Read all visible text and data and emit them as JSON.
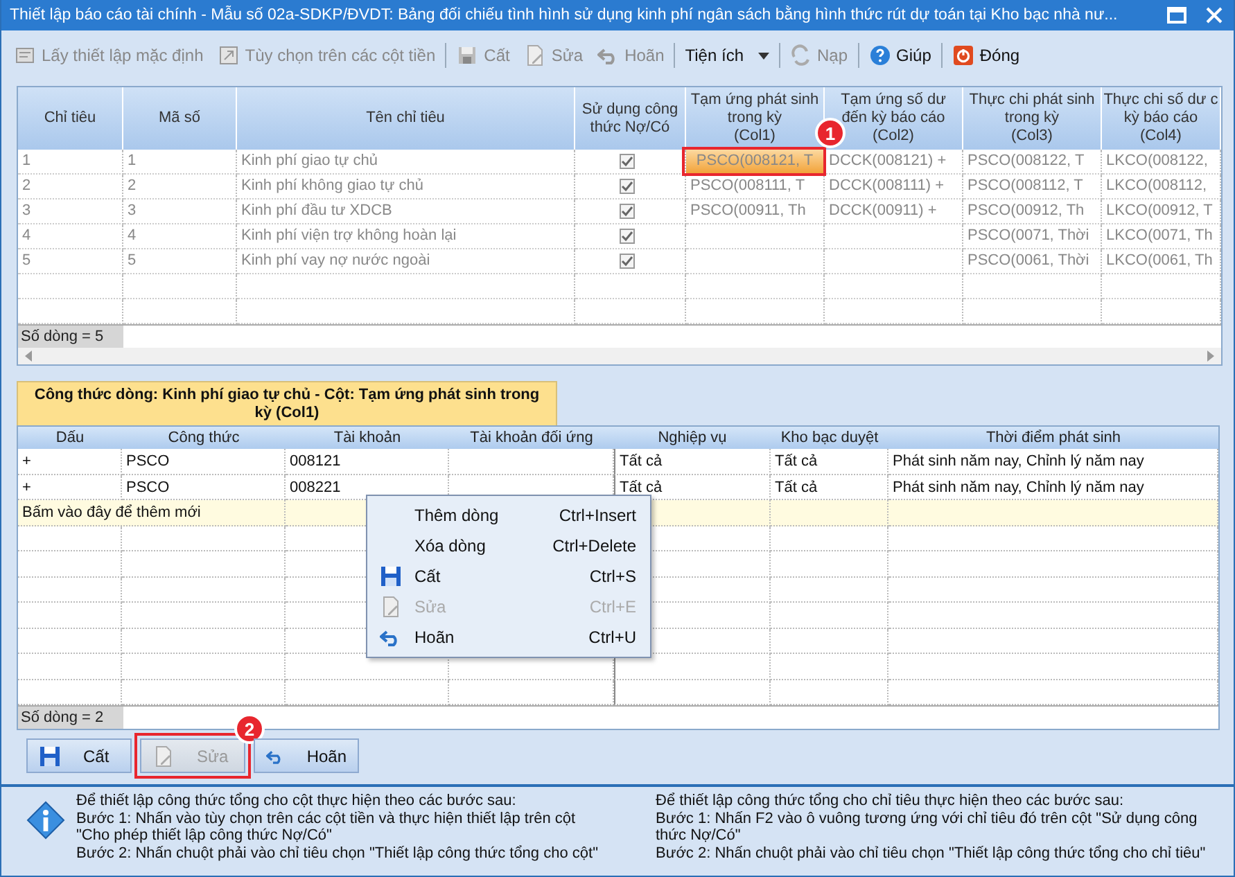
{
  "window": {
    "title": "Thiết lập báo cáo tài chính - Mẫu số 02a-SDKP/ĐVDT: Bảng đối chiếu tình hình sử dụng kinh phí ngân sách bằng hình thức rút dự toán tại Kho bạc nhà nư..."
  },
  "toolbar": [
    {
      "kind": "button",
      "label": "Lấy thiết lập mặc định",
      "disabled": true
    },
    {
      "kind": "button",
      "label": "Tùy chọn trên các cột tiền",
      "disabled": true
    },
    {
      "kind": "separator"
    },
    {
      "kind": "button",
      "label": "Cất",
      "disabled": true
    },
    {
      "kind": "button",
      "label": "Sửa",
      "disabled": true
    },
    {
      "kind": "button",
      "label": "Hoãn",
      "disabled": true
    },
    {
      "kind": "separator"
    },
    {
      "kind": "dropdown",
      "label": "Tiện ích",
      "disabled": false
    },
    {
      "kind": "separator"
    },
    {
      "kind": "button",
      "label": "Nạp",
      "disabled": true
    },
    {
      "kind": "separator"
    },
    {
      "kind": "button",
      "label": "Giúp",
      "disabled": false
    },
    {
      "kind": "separator"
    },
    {
      "kind": "button",
      "label": "Đóng",
      "disabled": false
    }
  ],
  "top_grid": {
    "columns": [
      "Chỉ tiêu",
      "Mã số",
      "Tên chỉ tiêu",
      "Sử dụng công\nthức Nợ/Có",
      "Tạm ứng phát sinh\ntrong kỳ\n(Col1)",
      "Tạm ứng số dư\nđến kỳ báo cáo\n(Col2)",
      "Thực chi phát sinh\ntrong kỳ\n(Col3)",
      "Thực chi số dư c\nkỳ báo cáo\n(Col4)"
    ],
    "rows": [
      {
        "checked": true,
        "cells": [
          "1",
          "1",
          "Kinh phí giao tự chủ",
          ""
        ],
        "values": [
          {
            "text": "PSCO(008121, T",
            "selected": true
          },
          {
            "text": "DCCK(008121) +",
            "selected": false
          },
          {
            "text": "PSCO(008122, T",
            "selected": false
          },
          {
            "text": "LKCO(008122,",
            "selected": false
          }
        ]
      },
      {
        "checked": true,
        "cells": [
          "2",
          "2",
          "Kinh phí không giao tự chủ",
          ""
        ],
        "values": [
          {
            "text": "PSCO(008111, T",
            "selected": false
          },
          {
            "text": "DCCK(008111) +",
            "selected": false
          },
          {
            "text": "PSCO(008112, T",
            "selected": false
          },
          {
            "text": "LKCO(008112,",
            "selected": false
          }
        ]
      },
      {
        "checked": true,
        "cells": [
          "3",
          "3",
          "Kinh phí đầu tư XDCB",
          ""
        ],
        "values": [
          {
            "text": "PSCO(00911, Th",
            "selected": false
          },
          {
            "text": "DCCK(00911) +",
            "selected": false
          },
          {
            "text": "PSCO(00912, Th",
            "selected": false
          },
          {
            "text": "LKCO(00912, T",
            "selected": false
          }
        ]
      },
      {
        "checked": true,
        "cells": [
          "4",
          "4",
          "Kinh phí viện trợ không hoàn lại",
          ""
        ],
        "values": [
          {
            "selected": false
          },
          {
            "selected": false
          },
          {
            "text": "PSCO(0071, Thời",
            "selected": false
          },
          {
            "text": "LKCO(0071, Th",
            "selected": false
          }
        ]
      },
      {
        "checked": true,
        "cells": [
          "5",
          "5",
          "Kinh phí vay nợ nước ngoài",
          ""
        ],
        "values": [
          {
            "selected": false
          },
          {
            "selected": false
          },
          {
            "text": "PSCO(0061, Thời",
            "selected": false
          },
          {
            "text": "LKCO(0061, Th",
            "selected": false
          }
        ]
      }
    ],
    "callout": "1",
    "status": "Số dòng = 5"
  },
  "formula_panel": {
    "tab": "Công thức dòng: Kinh phí giao tự chủ - Cột: Tạm ứng phát sinh trong kỳ (Col1)",
    "columns": [
      "Dấu",
      "Công thức",
      "Tài khoản",
      "Tài khoản đối ứng",
      "Nghiệp vụ",
      "Kho bạc duyệt",
      "Thời điểm phát sinh"
    ],
    "rows": [
      [
        "+",
        "PSCO",
        "008121",
        "",
        "Tất cả",
        "Tất cả",
        "Phát sinh năm nay, Chỉnh lý năm nay"
      ],
      [
        "+",
        "PSCO",
        "008221",
        "",
        "Tất cả",
        "Tất cả",
        "Phát sinh năm nay, Chỉnh lý năm nay"
      ]
    ],
    "new_row": "Bấm vào đây để thêm mới",
    "status": "Số dòng = 2"
  },
  "context_menu": [
    {
      "label": "Thêm dòng",
      "shortcut": "Ctrl+Insert",
      "disabled": false
    },
    {
      "label": "Xóa dòng",
      "shortcut": "Ctrl+Delete",
      "disabled": false
    },
    {
      "label": "Cất",
      "shortcut": "Ctrl+S",
      "disabled": false
    },
    {
      "label": "Sửa",
      "shortcut": "Ctrl+E",
      "disabled": true
    },
    {
      "label": "Hoãn",
      "shortcut": "Ctrl+U",
      "disabled": false
    }
  ],
  "buttons": [
    {
      "label": "Cất",
      "disabled": false
    },
    {
      "label": "Sửa",
      "disabled": true,
      "callout": "2"
    },
    {
      "label": "Hoãn",
      "disabled": false
    }
  ],
  "help": [
    {
      "lines": [
        "Để thiết lập công thức tổng cho cột thực hiện theo các bước sau:",
        "Bước 1: Nhấn vào tùy chọn trên các cột tiền và thực hiện thiết lập trên cột",
        "\"Cho phép thiết lập công thức Nợ/Có\"",
        "Bước 2: Nhấn chuột phải vào chỉ tiêu chọn \"Thiết lập công thức tổng cho cột\""
      ]
    },
    {
      "lines": [
        "Để thiết lập công thức tổng cho chỉ tiêu thực hiện theo các bước sau:",
        "Bước 1: Nhấn F2 vào ô vuông tương ứng với chỉ tiêu đó trên cột  \"Sử dụng công",
        "thức Nợ/Có\"",
        "Bước 2: Nhấn chuột phải vào chỉ tiêu chọn \"Thiết lập công thức tổng cho chỉ tiêu\""
      ]
    }
  ]
}
